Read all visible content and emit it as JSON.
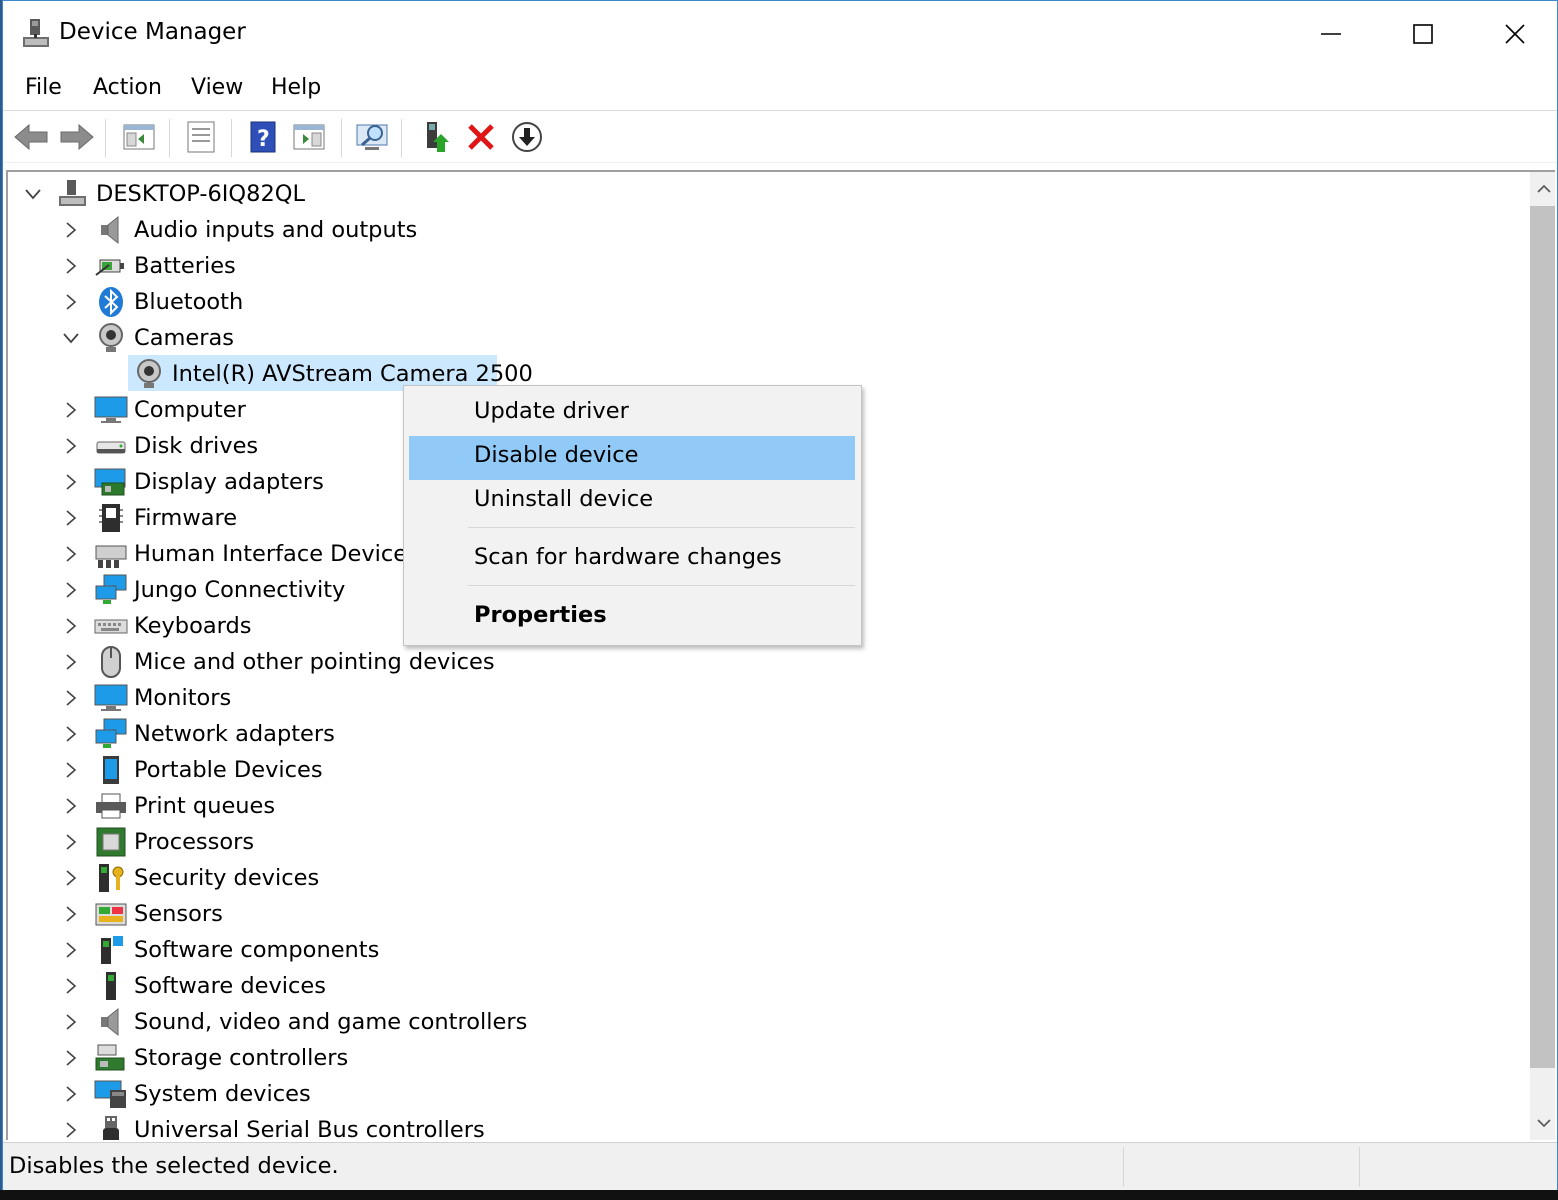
{
  "window": {
    "title": "Device Manager",
    "app_icon": "device-manager-icon"
  },
  "menu": {
    "items": [
      "File",
      "Action",
      "View",
      "Help"
    ]
  },
  "toolbar": {
    "buttons": [
      {
        "name": "back",
        "icon": "arrow-left-icon"
      },
      {
        "name": "forward",
        "icon": "arrow-right-icon"
      },
      {
        "name": "show-hide-console-tree",
        "icon": "console-tree-icon"
      },
      {
        "name": "properties",
        "icon": "properties-sheet-icon"
      },
      {
        "name": "help",
        "icon": "help-book-icon"
      },
      {
        "name": "show-action-pane",
        "icon": "action-pane-icon"
      },
      {
        "name": "scan-hardware",
        "icon": "monitor-magnifier-icon"
      },
      {
        "name": "update-driver",
        "icon": "update-driver-icon"
      },
      {
        "name": "uninstall-device",
        "icon": "red-x-icon"
      },
      {
        "name": "disable-device",
        "icon": "down-arrow-circle-icon"
      }
    ]
  },
  "tree": {
    "root": "DESKTOP-6IQ82QL",
    "categories": [
      "Audio inputs and outputs",
      "Batteries",
      "Bluetooth",
      "Cameras",
      "Computer",
      "Disk drives",
      "Display adapters",
      "Firmware",
      "Human Interface Devices",
      "Jungo Connectivity",
      "Keyboards",
      "Mice and other pointing devices",
      "Monitors",
      "Network adapters",
      "Portable Devices",
      "Print queues",
      "Processors",
      "Security devices",
      "Sensors",
      "Software components",
      "Software devices",
      "Sound, video and game controllers",
      "Storage controllers",
      "System devices",
      "Universal Serial Bus controllers"
    ],
    "expanded_category": "Cameras",
    "selected_device": "Intel(R) AVStream Camera 2500"
  },
  "context_menu": {
    "update_driver": "Update driver",
    "disable_device": "Disable device",
    "uninstall_device": "Uninstall device",
    "scan": "Scan for hardware changes",
    "properties": "Properties",
    "highlighted": "Disable device"
  },
  "status": {
    "text": "Disables the selected device."
  },
  "colors": {
    "selection": "#cce8ff",
    "menu_highlight": "#91c9f7",
    "window_border": "#3c88d0"
  }
}
